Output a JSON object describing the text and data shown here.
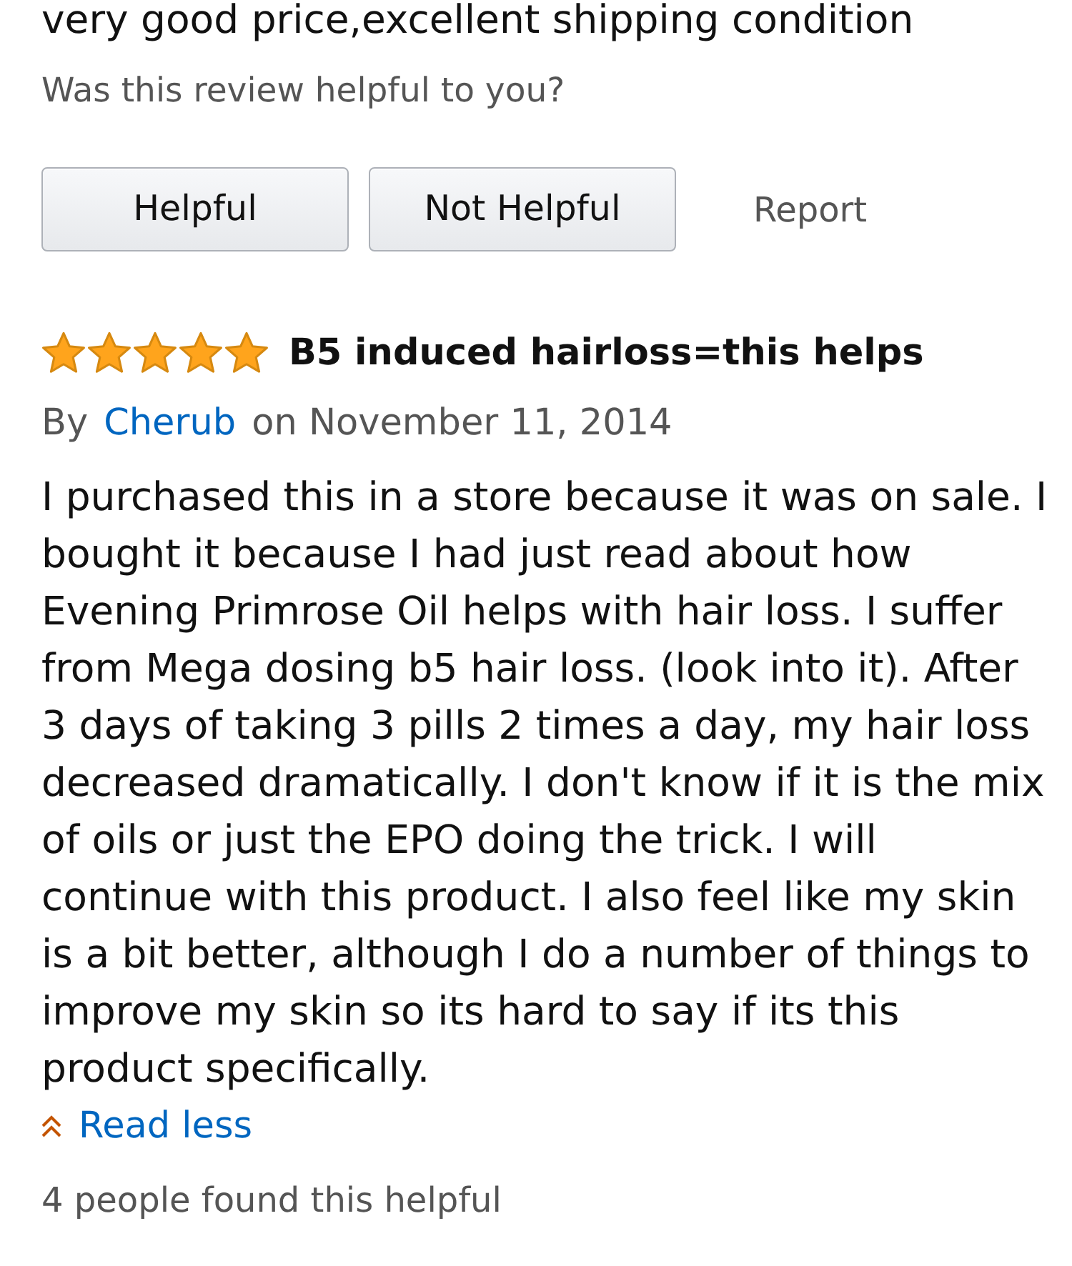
{
  "previous_review": {
    "body": "very good price,excellent shipping condition",
    "helpful_prompt": "Was this review helpful to you?",
    "buttons": [
      {
        "label": "Helpful"
      },
      {
        "label": "Not Helpful"
      }
    ],
    "report": "Report"
  },
  "review": {
    "stars": 5,
    "title": "B5 induced hairloss=this helps",
    "by_label": "By",
    "author": "Cherub",
    "date": "on November 11, 2014",
    "body": "I purchased this in a store because it was on sale. I bought it because I had just read about how Evening Primrose Oil helps with hair loss. I suffer from Mega dosing b5 hair loss. (look into it). After 3 days of taking 3 pills 2 times a day, my hair loss decreased dramatically. I don't know if it is the mix of oils or just the EPO doing the trick. I will continue with this product. I also feel like my skin is a bit better, although I do a number of things to improve my skin so its hard to say if its this product specifically.",
    "read_less": "Read less",
    "helpful_count": "4 people found this helpful"
  }
}
